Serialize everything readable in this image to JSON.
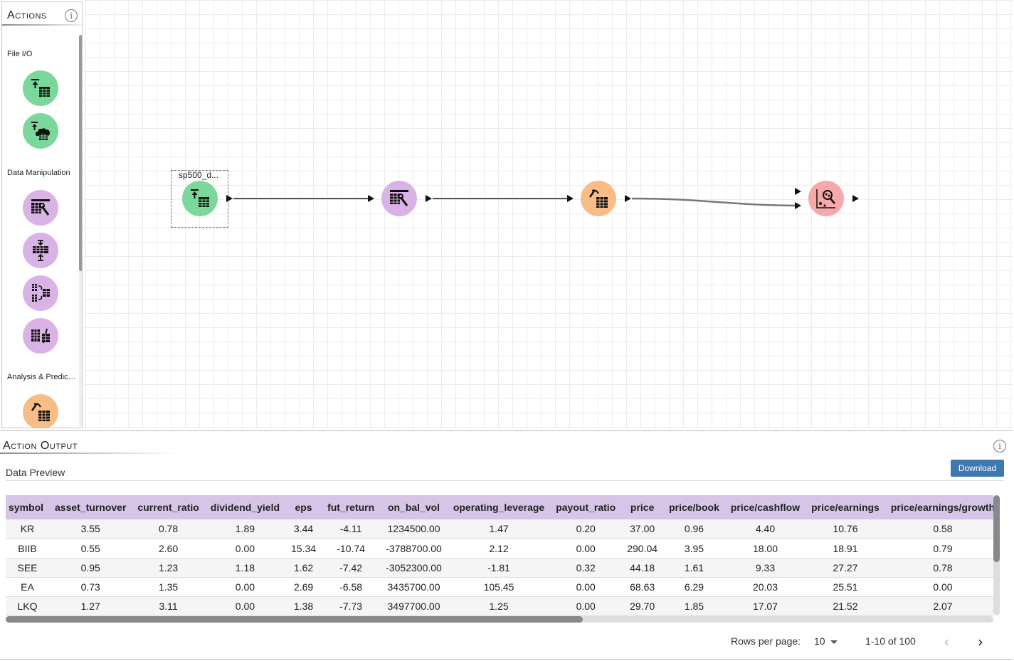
{
  "actions_panel": {
    "title": "Actions",
    "info_glyph": "i",
    "sections": [
      {
        "label": "File I/O",
        "tools": [
          {
            "icon": "table-upload-icon",
            "color": "#7ad99a"
          },
          {
            "icon": "cloud-table-upload-icon",
            "color": "#7ad99a"
          }
        ]
      },
      {
        "label": "Data Manipulation",
        "tools": [
          {
            "icon": "table-wrench-icon",
            "color": "#d9b3e5"
          },
          {
            "icon": "table-merge-icon",
            "color": "#d9b3e5"
          },
          {
            "icon": "table-join-icon",
            "color": "#d9b3e5"
          },
          {
            "icon": "table-split-icon",
            "color": "#d9b3e5"
          }
        ]
      },
      {
        "label": "Analysis & Prediction",
        "tools": [
          {
            "icon": "table-pickaxe-icon",
            "color": "#f8bd87"
          }
        ]
      }
    ]
  },
  "workflow": {
    "nodes": [
      {
        "name": "sp500_d...",
        "icon": "table-upload-icon",
        "color": "#7ad99a",
        "selected": true
      },
      {
        "name": "",
        "icon": "table-wrench-icon",
        "color": "#d9b3e5"
      },
      {
        "name": "",
        "icon": "table-pickaxe-icon",
        "color": "#f8bd87"
      },
      {
        "name": "",
        "icon": "scatter-search-icon",
        "color": "#f6a9ab"
      }
    ]
  },
  "output_panel": {
    "title": "Action Output",
    "info_glyph": "i",
    "preview_label": "Data Preview",
    "download_label": "Download",
    "columns": [
      "symbol",
      "asset_turnover",
      "current_ratio",
      "dividend_yield",
      "eps",
      "fut_return",
      "on_bal_vol",
      "operating_leverage",
      "payout_ratio",
      "price",
      "price/book",
      "price/cashflow",
      "price/earnings",
      "price/earnings/growth"
    ],
    "rows": [
      [
        "KR",
        "3.55",
        "0.78",
        "1.89",
        "3.44",
        "-4.11",
        "1234500.00",
        "1.47",
        "0.20",
        "37.00",
        "0.96",
        "4.40",
        "10.76",
        "0.58"
      ],
      [
        "BIIB",
        "0.55",
        "2.60",
        "0.00",
        "15.34",
        "-10.74",
        "-3788700.00",
        "2.12",
        "0.00",
        "290.04",
        "3.95",
        "18.00",
        "18.91",
        "0.79"
      ],
      [
        "SEE",
        "0.95",
        "1.23",
        "1.18",
        "1.62",
        "-7.42",
        "-3052300.00",
        "-1.81",
        "0.32",
        "44.18",
        "1.61",
        "9.33",
        "27.27",
        "0.78"
      ],
      [
        "EA",
        "0.73",
        "1.35",
        "0.00",
        "2.69",
        "-6.58",
        "3435700.00",
        "105.45",
        "0.00",
        "68.63",
        "6.29",
        "20.03",
        "25.51",
        "0.00"
      ],
      [
        "LKQ",
        "1.27",
        "3.11",
        "0.00",
        "1.38",
        "-7.73",
        "3497700.00",
        "1.25",
        "0.00",
        "29.70",
        "1.85",
        "17.07",
        "21.52",
        "2.07"
      ]
    ],
    "pagination": {
      "rows_per_page_label": "Rows per page:",
      "rows_per_page": "10",
      "range": "1-10 of 100",
      "prev_glyph": "‹",
      "next_glyph": "›"
    }
  }
}
